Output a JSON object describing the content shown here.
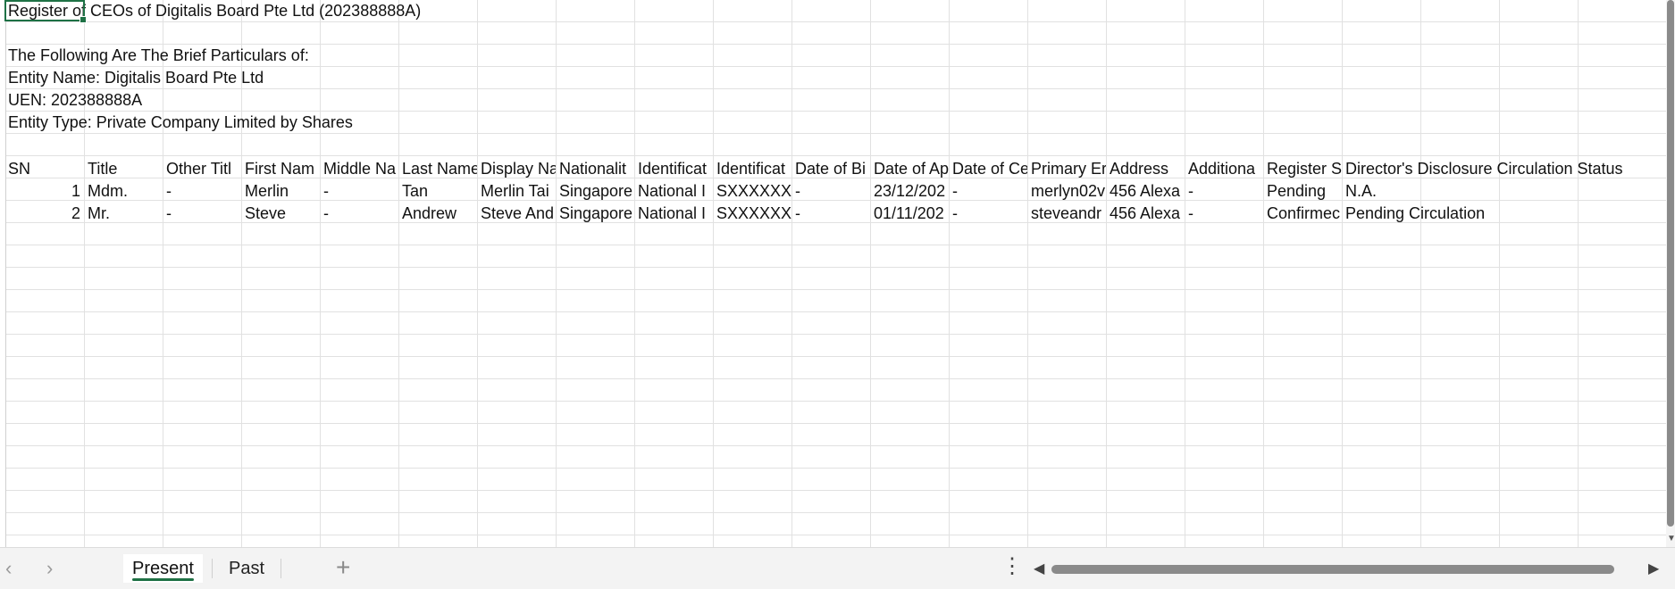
{
  "sheet": {
    "title": "Register of CEOs of Digitalis Board Pte Ltd (202388888A)",
    "intro": "The Following Are The Brief Particulars of:",
    "entity_name": "Entity Name: Digitalis Board Pte Ltd",
    "uen": "UEN: 202388888A",
    "entity_type": "Entity Type: Private Company Limited by Shares",
    "headers": [
      "SN",
      "Title",
      "Other Titl",
      "First Nam",
      "Middle Na",
      "Last Name",
      "Display Na",
      "Nationalit",
      "Identificat",
      "Identificat",
      "Date of Bi",
      "Date of Ap",
      "Date of Ce",
      "Primary Er",
      "Address",
      "Additiona",
      "Register S",
      "Director's Disclosure Circulation Status"
    ],
    "rows": [
      [
        "1",
        "Mdm.",
        "-",
        "Merlin",
        "-",
        "Tan",
        "Merlin Tai",
        "Singapore",
        "National I",
        "SXXXXXXX)",
        "-",
        "23/12/202",
        "-",
        "merlyn02v",
        "456 Alexa",
        "-",
        "Pending",
        "N.A."
      ],
      [
        "2",
        "Mr.",
        "-",
        "Steve",
        "-",
        "Andrew",
        "Steve And",
        "Singapore",
        "National I",
        "SXXXXXXX/",
        "-",
        "01/11/202",
        "-",
        "steveandr",
        "456 Alexa",
        "-",
        "Confirmec",
        "Pending Circulation"
      ]
    ]
  },
  "tabs": [
    {
      "label": "Present",
      "active": true
    },
    {
      "label": "Past",
      "active": false
    }
  ],
  "icons": {
    "prev": "‹",
    "next": "›",
    "add": "+",
    "more": "⋮",
    "scroll_left": "◀",
    "scroll_right": "▶",
    "scroll_down": "▼"
  },
  "colors": {
    "accent": "#1e7145",
    "gridline": "#e1e1e1"
  }
}
